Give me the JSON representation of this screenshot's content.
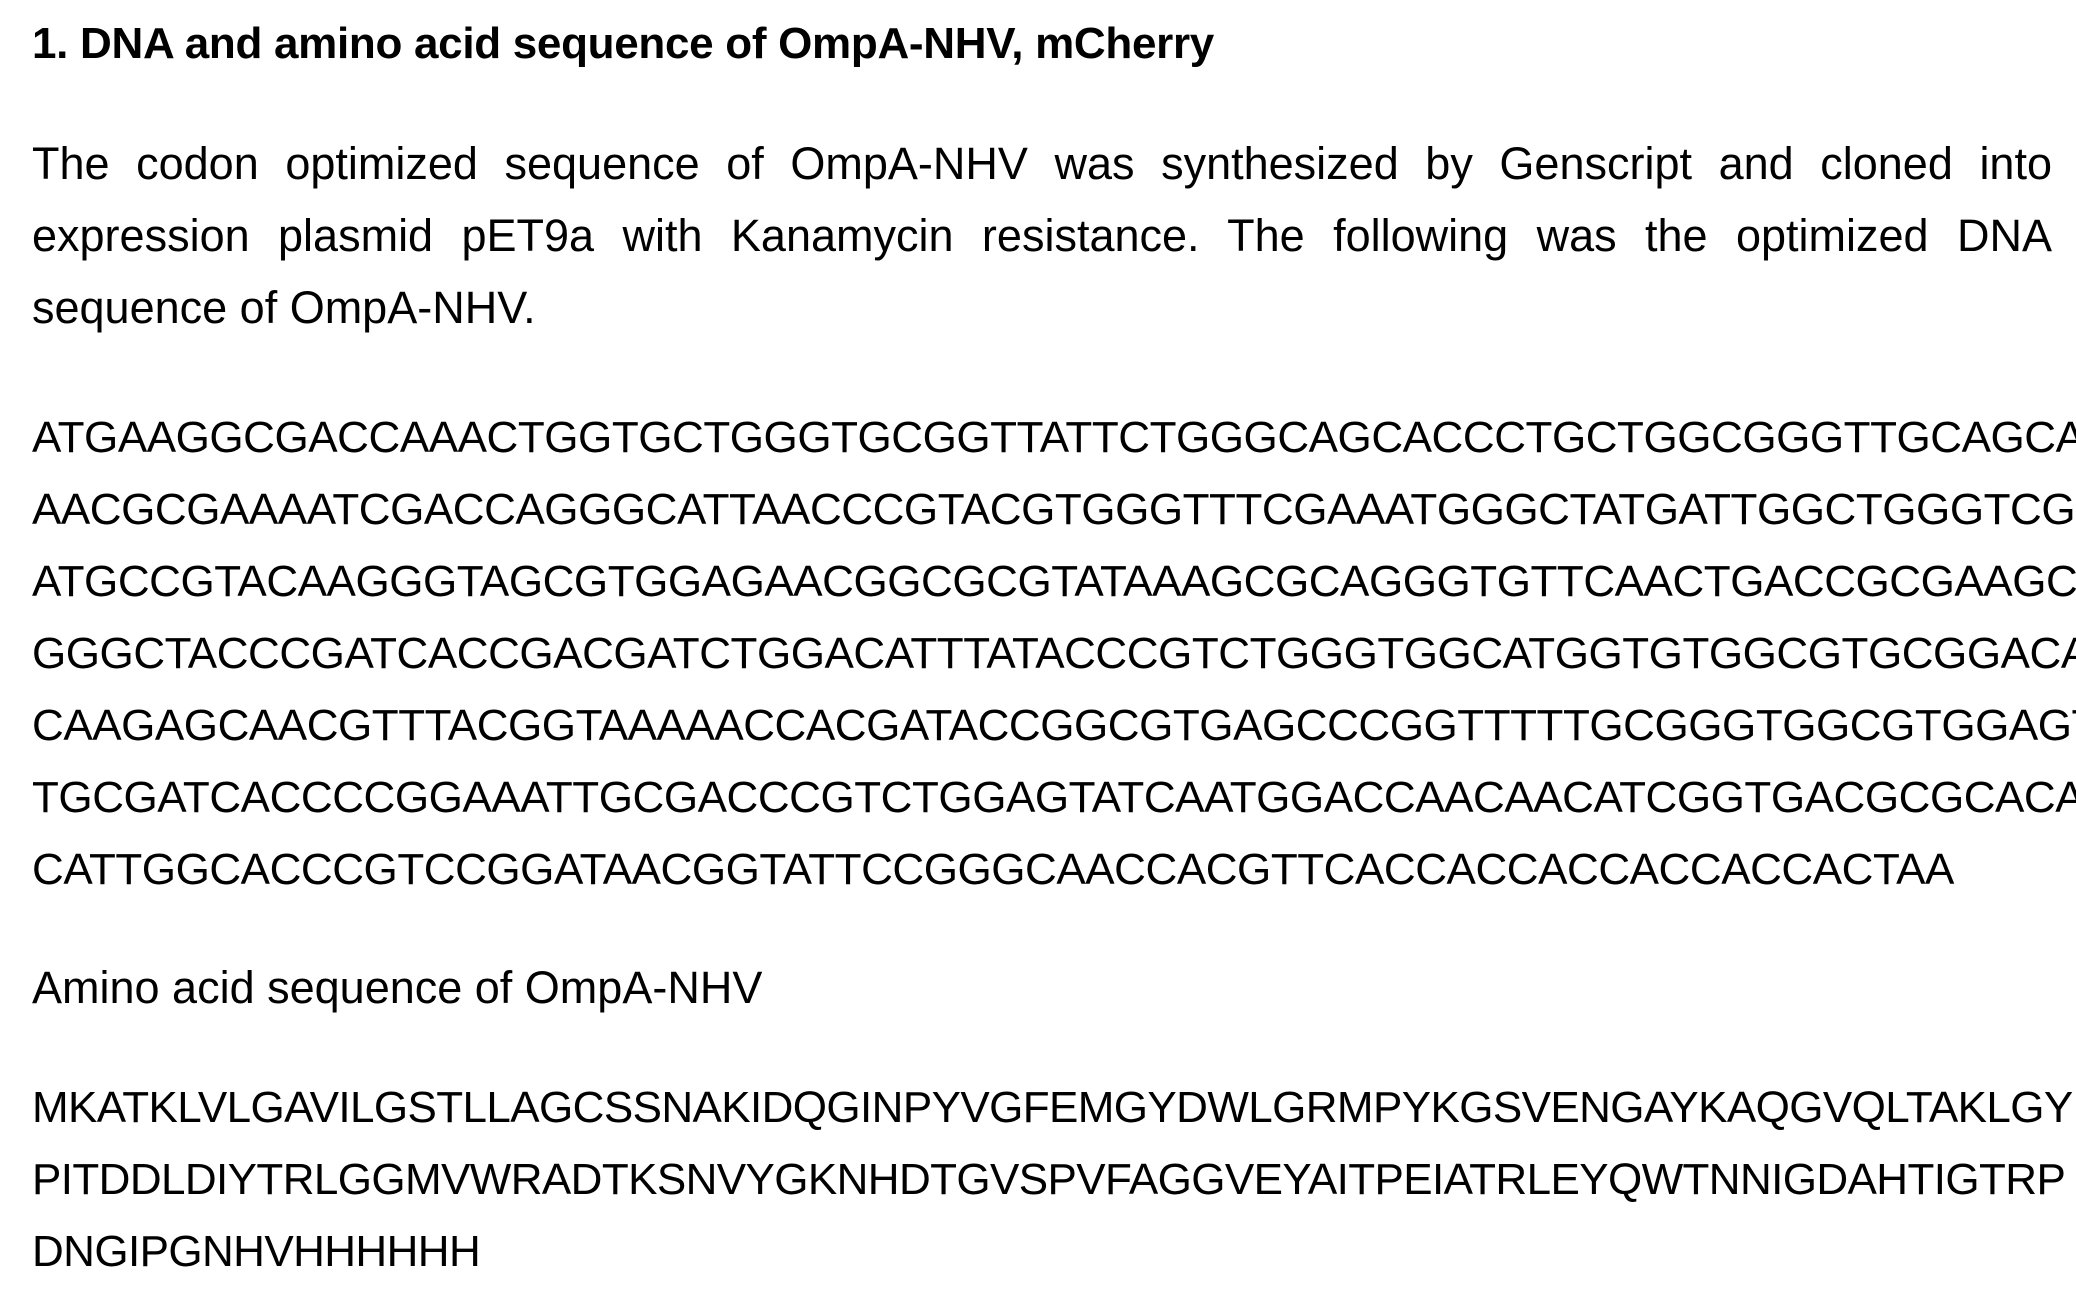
{
  "heading": "1. DNA and amino acid sequence of OmpA-NHV, mCherry",
  "intro_paragraph": "The codon optimized sequence of OmpA-NHV was synthesized by Genscript and cloned into expression plasmid pET9a with Kanamycin resistance. The following was the optimized DNA sequence of OmpA-NHV.",
  "dna_sequence_lines": [
    "ATGAAGGCGACCAAACTGGTGCTGGGTGCGGTTATTCTGGGCAGCACCCTGCTGGCGGGTTGCAGCAGC",
    "AACGCGAAAATCGACCAGGGCATTAACCCGTACGTGGGTTTCGAAATGGGCTATGATTGGCTGGGTCGT",
    "ATGCCGTACAAGGGTAGCGTGGAGAACGGCGCGTATAAAGCGCAGGGTGTTCAACTGACCGCGAAGCT",
    "GGGCTACCCGATCACCGACGATCTGGACATTTATACCCGTCTGGGTGGCATGGTGTGGCGTGCGGACAC",
    "CAAGAGCAACGTTTACGGTAAAAACCACGATACCGGCGTGAGCCCGGTTTTTGCGGGTGGCGTGGAGTA",
    "TGCGATCACCCCGGAAATTGCGACCCGTCTGGAGTATCAATGGACCAACAACATCGGTGACGCGCACAC",
    "CATTGGCACCCGTCCGGATAACGGTATTCCGGGCAACCACGTTCACCACCACCACCACCACTAA"
  ],
  "amino_acid_heading": "Amino acid sequence of OmpA-NHV",
  "amino_acid_lines": [
    "MKATKLVLGAVILGSTLLAGCSSNAKIDQGINPYVGFEMGYDWLGRMPYKGSVENGAYKAQGVQLTAKLGY",
    "PITDDLDIYTRLGGMVWRADTKSNVYGKNHDTGVSPVFAGGVEYAITPEIATRLEYQWTNNIGDAHTIGTRP",
    "DNGIPGNHVHHHHHH"
  ]
}
